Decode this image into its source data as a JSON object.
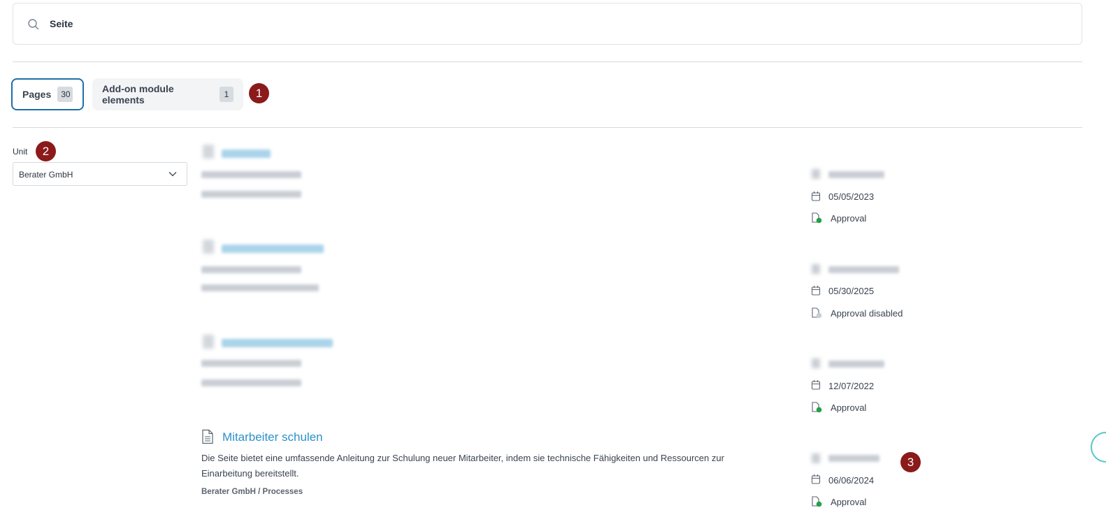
{
  "search": {
    "value": "Seite",
    "icon": "search-icon"
  },
  "tabs": [
    {
      "label": "Pages",
      "count": "30",
      "active": true
    },
    {
      "label": "Add-on module elements",
      "count": "1",
      "active": false
    }
  ],
  "markers": [
    "1",
    "2",
    "3"
  ],
  "filter": {
    "label": "Unit",
    "selected": "Berater GmbH"
  },
  "results": [
    {
      "title": "",
      "date": "05/05/2023",
      "status": "Approval",
      "status_color": "#22a04a"
    },
    {
      "title": "",
      "date": "05/30/2025",
      "status": "Approval disabled",
      "status_color": "#c9ced4"
    },
    {
      "title": "",
      "date": "12/07/2022",
      "status": "Approval",
      "status_color": "#22a04a"
    },
    {
      "title": "Mitarbeiter schulen",
      "description": "Die Seite bietet eine umfassende Anleitung zur Schulung neuer Mitarbeiter, indem sie technische Fähigkeiten und Ressourcen zur Einarbeitung bereitstellt.",
      "path": "Berater GmbH / Processes",
      "date": "06/06/2024",
      "status": "Approval",
      "status_color": "#22a04a"
    }
  ],
  "colors": {
    "accent": "#1f6fa8",
    "link": "#2b91c9",
    "marker": "#8b1a1a",
    "approved": "#22a04a"
  }
}
